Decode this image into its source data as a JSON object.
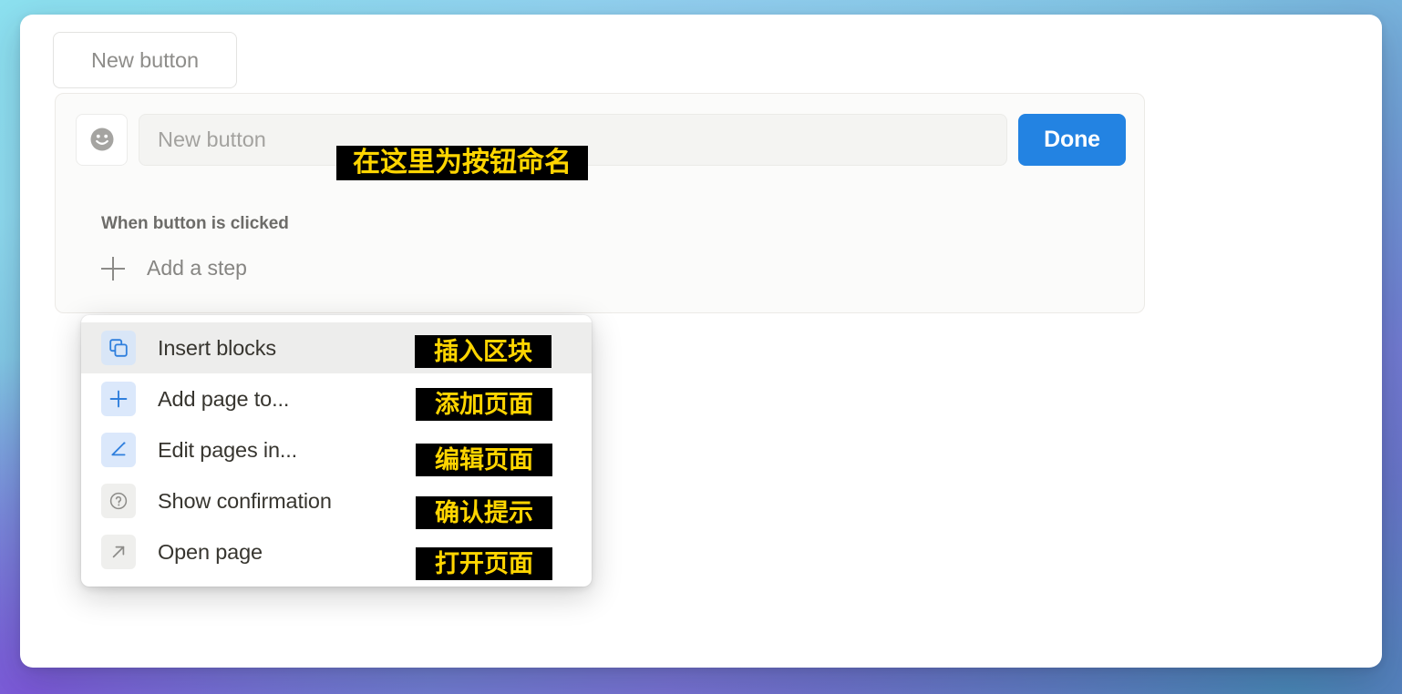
{
  "background": {
    "gradient_from": "#8ce0ef",
    "gradient_to": "#8b63d6"
  },
  "toolbar": {
    "new_button_label": "New button"
  },
  "config_card": {
    "emoji_icon": "smiley-face-icon",
    "name_input": {
      "value": "",
      "placeholder": "New button",
      "annotation": "在这里为按钮命名"
    },
    "done_label": "Done",
    "trigger_label": "When button is clicked",
    "add_step_label": "Add a step",
    "add_step_icon": "plus-icon"
  },
  "menu": {
    "items": [
      {
        "label": "Insert blocks",
        "icon": "duplicate-blocks-icon",
        "icon_style": "blue",
        "annotation": "插入区块",
        "active": true
      },
      {
        "label": "Add page to...",
        "icon": "plus-icon",
        "icon_style": "blue2",
        "annotation": "添加页面",
        "active": false
      },
      {
        "label": "Edit pages in...",
        "icon": "pencil-edit-icon",
        "icon_style": "blue2",
        "annotation": "编辑页面",
        "active": false
      },
      {
        "label": "Show confirmation",
        "icon": "question-circle-icon",
        "icon_style": "gray",
        "annotation": "确认提示",
        "active": false
      },
      {
        "label": "Open page",
        "icon": "arrow-up-right-icon",
        "icon_style": "gray",
        "annotation": "打开页面",
        "active": false
      }
    ]
  },
  "colors": {
    "accent_blue": "#2383e2",
    "annotation_bg": "#000000",
    "annotation_fg": "#ffd500",
    "text_primary": "#37352f",
    "text_muted": "#8e8d8a"
  }
}
